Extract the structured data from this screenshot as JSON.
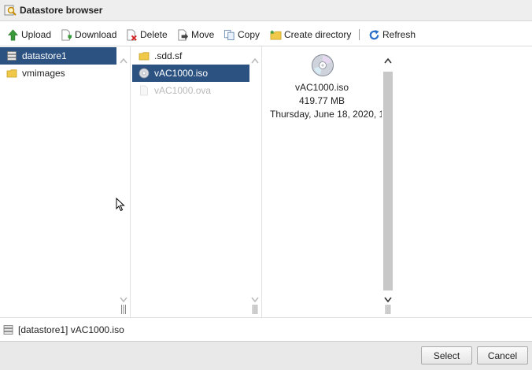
{
  "window": {
    "title": "Datastore browser",
    "title_icon": "search-datastore-icon"
  },
  "toolbar": {
    "upload": "Upload",
    "download": "Download",
    "delete": "Delete",
    "move": "Move",
    "copy": "Copy",
    "create_directory": "Create directory",
    "refresh": "Refresh"
  },
  "datastores": [
    {
      "label": "datastore1",
      "icon": "database-icon",
      "selected": true
    },
    {
      "label": "vmimages",
      "icon": "folder-icon",
      "selected": false
    }
  ],
  "files": [
    {
      "label": ".sdd.sf",
      "icon": "folder-icon",
      "selected": false,
      "disabled": false
    },
    {
      "label": "vAC1000.iso",
      "icon": "disc-icon",
      "selected": true,
      "disabled": false
    },
    {
      "label": "vAC1000.ova",
      "icon": "file-icon",
      "selected": false,
      "disabled": true
    }
  ],
  "details": {
    "icon": "disc-icon",
    "name": "vAC1000.iso",
    "size": "419.77 MB",
    "modified": "Thursday, June 18, 2020, 1"
  },
  "status": {
    "path": "[datastore1] vAC1000.iso",
    "icon": "database-icon"
  },
  "buttons": {
    "select": "Select",
    "cancel": "Cancel"
  },
  "colors": {
    "selection": "#2c5282",
    "toolbar_green": "#3a9a3a",
    "refresh_blue": "#2a6fc9"
  }
}
